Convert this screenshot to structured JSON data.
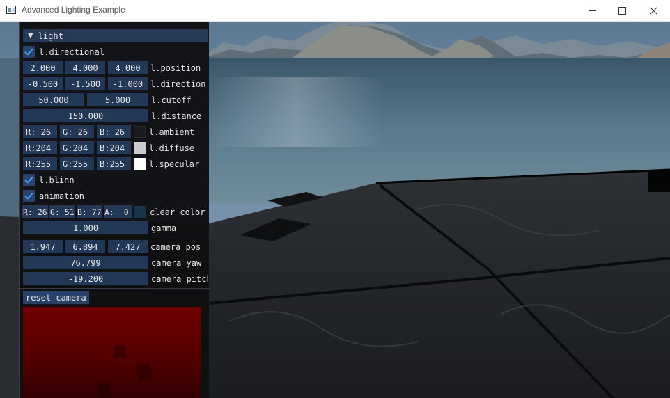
{
  "window": {
    "title": "Advanced Lighting Example",
    "controls": {
      "minimize": "minimize-icon",
      "maximize": "maximize-icon",
      "close": "close-icon"
    }
  },
  "panel": {
    "header": "light",
    "directional": {
      "label": "l.directional",
      "checked": true
    },
    "position": {
      "values": [
        "2.000",
        "4.000",
        "4.000"
      ],
      "label": "l.position"
    },
    "direction": {
      "values": [
        "-0.500",
        "-1.500",
        "-1.000"
      ],
      "label": "l.direction"
    },
    "cutoff": {
      "values": [
        "50.000",
        "5.000"
      ],
      "label": "l.cutoff"
    },
    "distance": {
      "value": "150.000",
      "label": "l.distance"
    },
    "ambient": {
      "values": [
        "R: 26",
        "G: 26",
        "B: 26"
      ],
      "label": "l.ambient",
      "color": "#1a1a1a"
    },
    "diffuse": {
      "values": [
        "R:204",
        "G:204",
        "B:204"
      ],
      "label": "l.diffuse",
      "color": "#cccccc"
    },
    "specular": {
      "values": [
        "R:255",
        "G:255",
        "B:255"
      ],
      "label": "l.specular",
      "color": "#ffffff"
    },
    "blinn": {
      "label": "l.blinn",
      "checked": true
    },
    "animation": {
      "label": "animation",
      "checked": true
    },
    "clear_color": {
      "values": [
        "R: 26",
        "G: 51",
        "B: 77",
        "A:  0"
      ],
      "label": "clear color",
      "color": "#1a334d"
    },
    "gamma": {
      "value": "1.000",
      "label": "gamma"
    },
    "camera_pos": {
      "values": [
        "1.947",
        "6.894",
        "7.427"
      ],
      "label": "camera pos"
    },
    "camera_yaw": {
      "value": "76.799",
      "label": "camera yaw"
    },
    "camera_pitch": {
      "value": "-19.200",
      "label": "camera pitch"
    },
    "reset_button": "reset camera"
  },
  "colors": {
    "panel_bg": "#101012",
    "field_bg": "#233756",
    "header_bg": "#263a57",
    "check_bg": "#29426b",
    "check_mark": "#4aa3ff",
    "preview_red": "#6e0000"
  }
}
